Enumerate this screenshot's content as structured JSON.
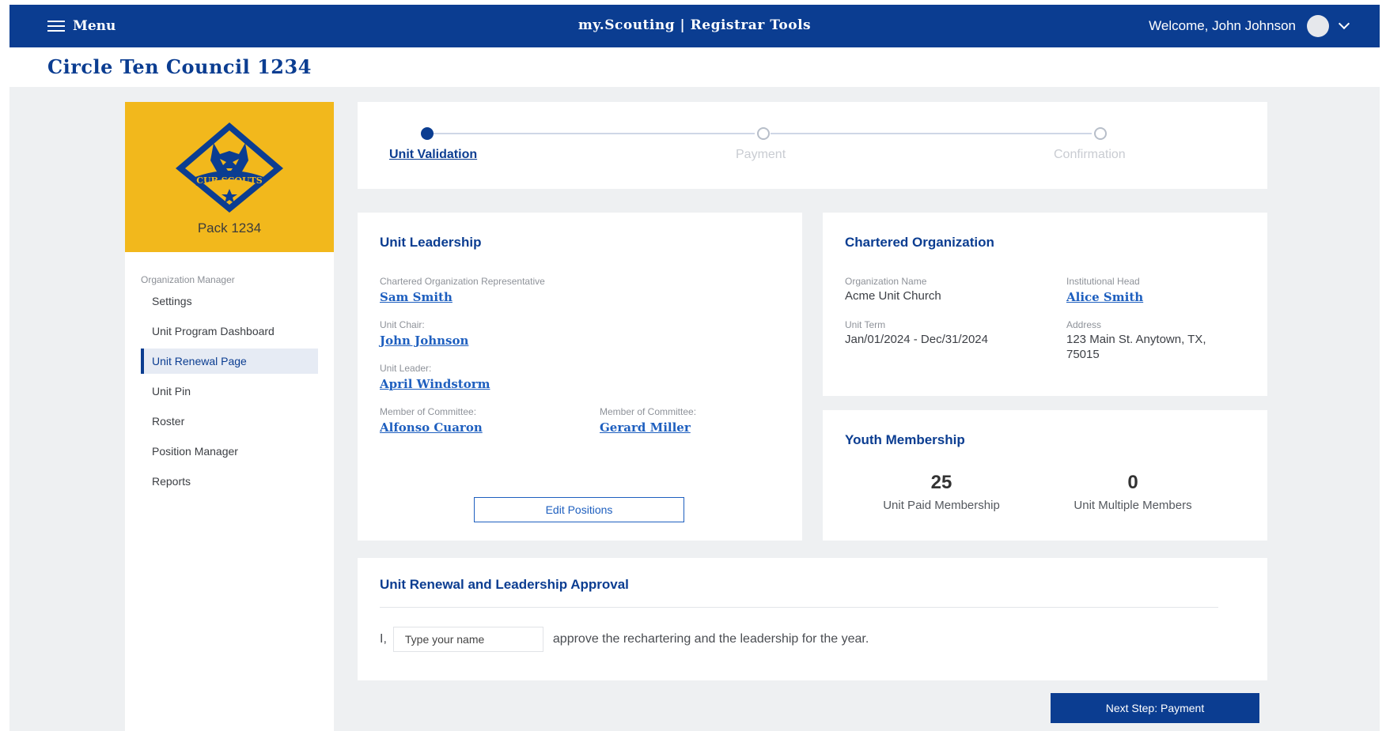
{
  "header": {
    "menu_label": "Menu",
    "app_title": "my.Scouting | Registrar Tools",
    "welcome_text": "Welcome, John Johnson"
  },
  "council": {
    "title": "Circle Ten Council 1234"
  },
  "sidebar": {
    "unit_name": "Pack 1234",
    "logo_text": "CUB SCOUTS",
    "section_label": "Organization Manager",
    "items": [
      {
        "label": "Settings",
        "active": false
      },
      {
        "label": "Unit Program Dashboard",
        "active": false
      },
      {
        "label": "Unit Renewal Page",
        "active": true
      },
      {
        "label": "Unit Pin",
        "active": false
      },
      {
        "label": "Roster",
        "active": false
      },
      {
        "label": "Position Manager",
        "active": false
      },
      {
        "label": "Reports",
        "active": false
      }
    ]
  },
  "stepper": {
    "steps": [
      {
        "label": "Unit Validation",
        "state": "current"
      },
      {
        "label": "Payment",
        "state": "upcoming"
      },
      {
        "label": "Confirmation",
        "state": "upcoming"
      }
    ]
  },
  "leadership": {
    "title": "Unit Leadership",
    "cor_label": "Chartered Organization Representative",
    "cor_name": "Sam Smith",
    "chair_label": "Unit Chair:",
    "chair_name": "John Johnson",
    "leader_label": "Unit Leader:",
    "leader_name": "April Windstorm",
    "committee": [
      {
        "label": "Member of Committee:",
        "name": "Alfonso Cuaron"
      },
      {
        "label": "Member of Committee:",
        "name": "Gerard Miller"
      }
    ],
    "edit_button": "Edit Positions"
  },
  "chartered_org": {
    "title": "Chartered Organization",
    "org_name_label": "Organization Name",
    "org_name": "Acme Unit Church",
    "head_label": "Institutional Head",
    "head_name": "Alice Smith",
    "term_label": "Unit Term",
    "term": "Jan/01/2024 - Dec/31/2024",
    "address_label": "Address",
    "address_line1": "123 Main St. Anytown, TX,",
    "address_line2": "75015"
  },
  "youth": {
    "title": "Youth Membership",
    "paid_count": "25",
    "paid_label": "Unit Paid Membership",
    "multiple_count": "0",
    "multiple_label": "Unit Multiple Members"
  },
  "approval": {
    "title": "Unit Renewal and Leadership Approval",
    "prefix": "I,",
    "name_value": "",
    "name_placeholder": "Type your name",
    "suffix": "approve the rechartering and the leadership for the year."
  },
  "next_button": "Next Step: Payment",
  "colors": {
    "brand_blue": "#0b3d91",
    "link_blue": "#1e5fbf",
    "cub_gold": "#f2b81c",
    "page_bg": "#eef0f2"
  }
}
